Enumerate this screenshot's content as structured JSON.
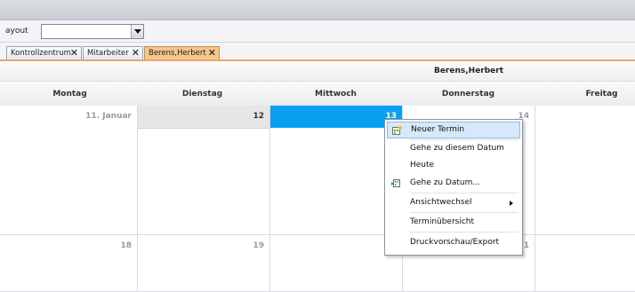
{
  "toolbar": {
    "layout_label": "ayout",
    "layout_value": ""
  },
  "tabs": [
    {
      "label": "Kontrollzentrum"
    },
    {
      "label": "Mitarbeiter"
    },
    {
      "label": "Berens,Herbert"
    }
  ],
  "calendar": {
    "owner": "Berens,Herbert",
    "weekdays": [
      "Montag",
      "Dienstag",
      "Mittwoch",
      "Donnerstag",
      "Freitag"
    ],
    "week1": [
      "11. Januar",
      "12",
      "13",
      "14",
      ""
    ],
    "week2": [
      "18",
      "19",
      "",
      "21",
      ""
    ],
    "selected_color": "#0aa0f2",
    "today_color": "#e6e6e6"
  },
  "context_menu": {
    "items": [
      {
        "label": "Neuer Termin",
        "icon": "new-appointment-icon"
      },
      {
        "label": "Gehe zu diesem Datum"
      },
      {
        "label": "Heute"
      },
      {
        "label": "Gehe zu Datum...",
        "icon": "goto-date-icon"
      },
      {
        "label": "Ansichtwechsel",
        "submenu": true
      },
      {
        "label": "Terminübersicht"
      },
      {
        "label": "Druckvorschau/Export"
      }
    ]
  }
}
